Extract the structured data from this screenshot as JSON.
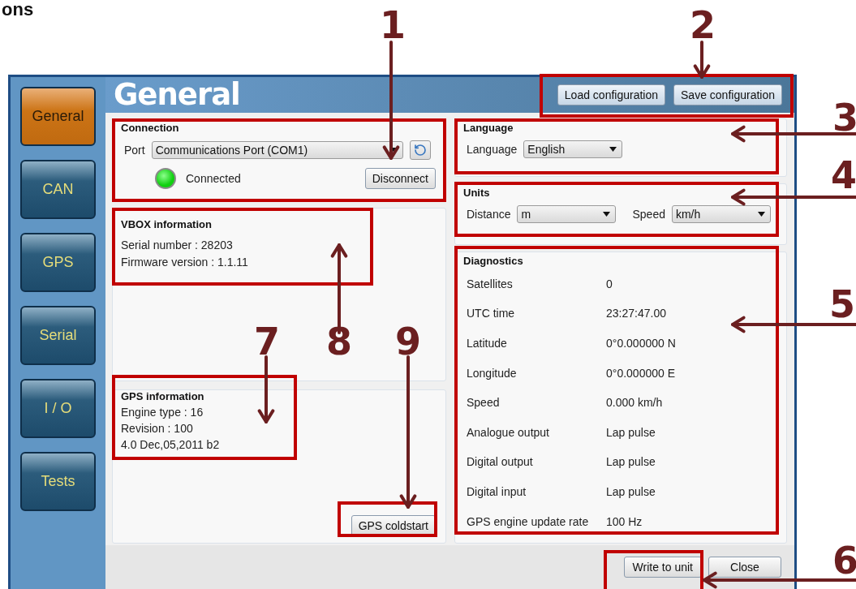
{
  "heading_fragment": "ons",
  "sidebar": {
    "items": [
      {
        "label": "General",
        "selected": true
      },
      {
        "label": "CAN",
        "selected": false
      },
      {
        "label": "GPS",
        "selected": false
      },
      {
        "label": "Serial",
        "selected": false
      },
      {
        "label": "I / O",
        "selected": false
      },
      {
        "label": "Tests",
        "selected": false
      }
    ]
  },
  "header": {
    "title": "General",
    "buttons": [
      "Load configuration",
      "Save configuration"
    ]
  },
  "connection": {
    "title": "Connection",
    "port_label": "Port",
    "port_value": "Communications Port (COM1)",
    "status": {
      "label": "Connected",
      "on": true
    },
    "disconnect": "Disconnect"
  },
  "vbox_info": {
    "title": "VBOX information",
    "lines": [
      "Serial number : 28203",
      "Firmware version : 1.1.11"
    ]
  },
  "gps_info": {
    "title": "GPS information",
    "lines": [
      "Engine type : 16",
      "Revision : 100",
      "4.0 Dec,05,2011 b2"
    ],
    "button": "GPS coldstart"
  },
  "language": {
    "title": "Language",
    "label": "Language",
    "value": "English"
  },
  "units": {
    "title": "Units",
    "fields": [
      {
        "label": "Distance",
        "value": "m"
      },
      {
        "label": "Speed",
        "value": "km/h"
      }
    ]
  },
  "diagnostics": {
    "title": "Diagnostics",
    "rows": [
      {
        "label": "Satellites",
        "value": "0"
      },
      {
        "label": "UTC time",
        "value": "23:27:47.00"
      },
      {
        "label": "Latitude",
        "value": "0°0.000000 N"
      },
      {
        "label": "Longitude",
        "value": "0°0.000000 E"
      },
      {
        "label": "Speed",
        "value": "0.000 km/h"
      },
      {
        "label": "Analogue output",
        "value": "Lap pulse"
      },
      {
        "label": "Digital output",
        "value": "Lap pulse"
      },
      {
        "label": "Digital input",
        "value": "Lap pulse"
      },
      {
        "label": "GPS engine update rate",
        "value": "100 Hz"
      }
    ]
  },
  "footer": {
    "buttons": [
      "Write to unit",
      "Close"
    ]
  },
  "callouts": [
    {
      "number": "1"
    },
    {
      "number": "2"
    },
    {
      "number": "3"
    },
    {
      "number": "4"
    },
    {
      "number": "5"
    },
    {
      "number": "6"
    },
    {
      "number": "7"
    },
    {
      "number": "8"
    },
    {
      "number": "9"
    }
  ]
}
